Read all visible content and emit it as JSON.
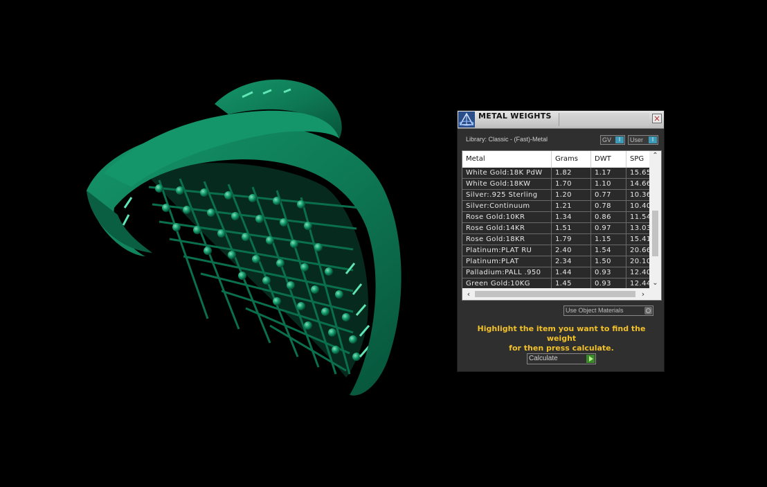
{
  "dialog": {
    "title": "METAL WEIGHTS",
    "close_label": "×",
    "library_label": "Library: Classic - (Fast)-Metal",
    "toggle_gv": "GV",
    "toggle_user": "User",
    "toggle_knob": "I",
    "use_object_materials": "Use Object Materials",
    "instructions_line1": "Highlight the item you want to find the weight",
    "instructions_line2": "for then press calculate.",
    "calculate_label": "Calculate"
  },
  "table": {
    "headers": [
      "Metal",
      "Grams",
      "DWT",
      "SPG"
    ],
    "rows": [
      [
        "White Gold:18K PdW",
        "1.82",
        "1.17",
        "15.65"
      ],
      [
        "White Gold:18KW",
        "1.70",
        "1.10",
        "14.66"
      ],
      [
        "Silver:.925 Sterling",
        "1.20",
        "0.77",
        "10.36"
      ],
      [
        "Silver:Continuum",
        "1.21",
        "0.78",
        "10.40"
      ],
      [
        "Rose Gold:10KR",
        "1.34",
        "0.86",
        "11.54"
      ],
      [
        "Rose Gold:14KR",
        "1.51",
        "0.97",
        "13.03"
      ],
      [
        "Rose Gold:18KR",
        "1.79",
        "1.15",
        "15.41"
      ],
      [
        "Platinum:PLAT RU",
        "2.40",
        "1.54",
        "20.66"
      ],
      [
        "Platinum:PLAT",
        "2.34",
        "1.50",
        "20.10"
      ],
      [
        "Palladium:PALL .950",
        "1.44",
        "0.93",
        "12.40"
      ],
      [
        "Green Gold:10KG",
        "1.45",
        "0.93",
        "12.44"
      ]
    ]
  },
  "colors": {
    "ring_green": "#0e7a55",
    "instructions_yellow": "#f2c12a",
    "toggle_accent": "#3d99b8"
  },
  "icons": {
    "app": "pyramid-logo-icon",
    "close": "close-icon",
    "scroll_up": "chevron-up-icon",
    "scroll_down": "chevron-down-icon",
    "scroll_left": "chevron-left-icon",
    "scroll_right": "chevron-right-icon",
    "calculate": "play-icon"
  }
}
